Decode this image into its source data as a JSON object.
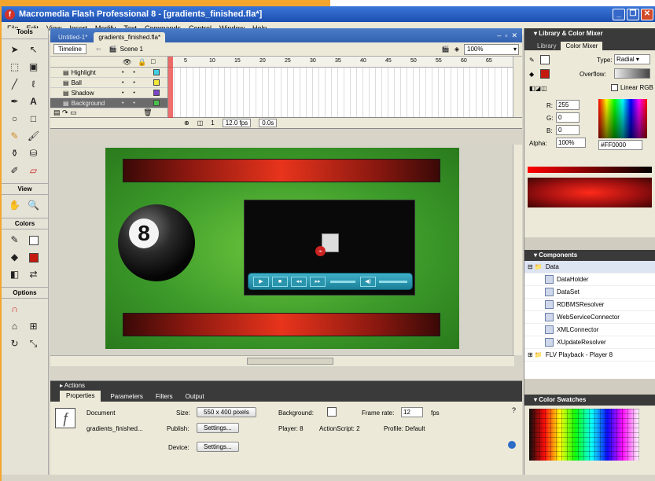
{
  "window": {
    "title": "Macromedia Flash Professional 8 - [gradients_finished.fla*]",
    "logo": "flash-logo",
    "controls": [
      "minimize",
      "restore",
      "close"
    ]
  },
  "menu": [
    "File",
    "Edit",
    "View",
    "Insert",
    "Modify",
    "Text",
    "Commands",
    "Control",
    "Window",
    "Help"
  ],
  "tools": {
    "header": "Tools",
    "items": [
      "arrow-icon",
      "subselect-icon",
      "free-transform-icon",
      "gradient-transform-icon",
      "line-icon",
      "lasso-icon",
      "pen-icon",
      "text-icon",
      "oval-icon",
      "rectangle-icon",
      "pencil-icon",
      "brush-icon",
      "ink-bottle-icon",
      "paint-bucket-icon",
      "eyedropper-icon",
      "eraser-icon"
    ],
    "view_header": "View",
    "colors_header": "Colors",
    "options_header": "Options"
  },
  "document": {
    "tabs": [
      "Untitled-1*",
      "gradients_finished.fla*"
    ],
    "timeline_button": "Timeline",
    "scene": "Scene 1",
    "zoom": "100%",
    "layers": [
      {
        "name": "Highlight",
        "color": "#3fd0e8"
      },
      {
        "name": "Ball",
        "color": "#f4e83a"
      },
      {
        "name": "Shadow",
        "color": "#7a45c8"
      },
      {
        "name": "Background",
        "color": "#4ac04a"
      }
    ],
    "frame_numbers": [
      "5",
      "10",
      "15",
      "20",
      "25",
      "30",
      "35",
      "40",
      "45",
      "50",
      "55",
      "60",
      "65"
    ],
    "current_frame": "1",
    "fps": "12.0 fps",
    "time": "0.0s"
  },
  "stage": {
    "ball_number": "8"
  },
  "panels": {
    "actions": "Actions",
    "tabs": [
      "Properties",
      "Parameters",
      "Filters",
      "Output"
    ],
    "document_label": "Document",
    "document_name": "gradients_finished...",
    "size_label": "Size:",
    "size_value": "550 x 400 pixels",
    "background_label": "Background:",
    "frame_rate_label": "Frame rate:",
    "frame_rate": "12",
    "fps_label": "fps",
    "publish_label": "Publish:",
    "settings_label": "Settings...",
    "player": "Player: 8",
    "actionscript": "ActionScript: 2",
    "profile": "Profile: Default",
    "device_label": "Device:"
  },
  "library": {
    "header": "Library & Color Mixer",
    "tabs": [
      "Library",
      "Color Mixer"
    ],
    "type_label": "Type:",
    "type_value": "Radial",
    "overflow_label": "Overflow:",
    "linear_rgb": "Linear RGB",
    "r_label": "R:",
    "r": "255",
    "g_label": "G:",
    "g": "0",
    "b_label": "B:",
    "b": "0",
    "alpha_label": "Alpha:",
    "alpha": "100%",
    "hex": "#FF0000"
  },
  "components": {
    "header": "Components",
    "category": "Data",
    "items": [
      "DataHolder",
      "DataSet",
      "RDBMSResolver",
      "WebServiceConnector",
      "XMLConnector",
      "XUpdateResolver"
    ],
    "next_category": "FLV Playback - Player 8"
  },
  "swatches": {
    "header": "Color Swatches"
  }
}
